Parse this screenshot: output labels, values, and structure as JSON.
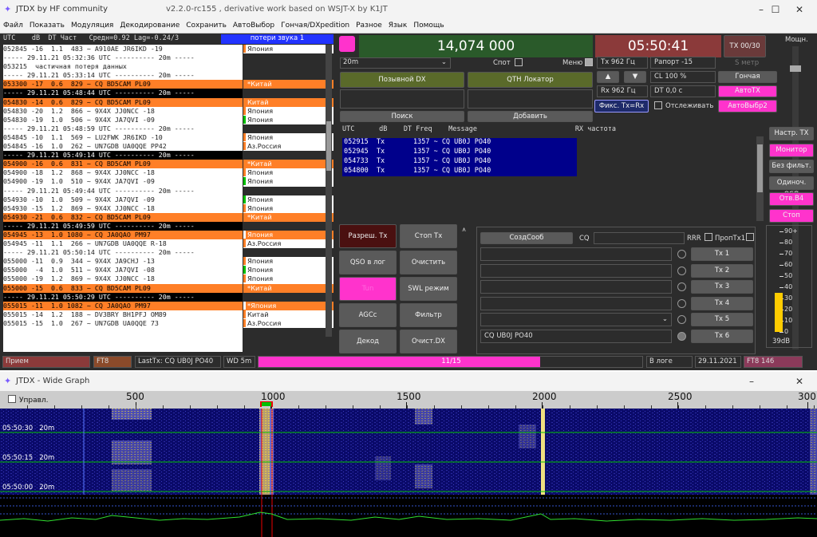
{
  "window": {
    "title": "JTDX  by HF community",
    "version": "v2.2.0-rc155 , derivative work based on WSJT-X by K1JT",
    "minimize": "–",
    "maximize": "☐",
    "close": "✕"
  },
  "menu": [
    "Файл",
    "Показать",
    "Модуляция",
    "Декодирование",
    "Сохранить",
    "АвтоВыбор",
    "Гончая/DXpedition",
    "Разное",
    "Язык",
    "Помощь"
  ],
  "header": {
    "utc": "UTC",
    "db": "dB",
    "dt": "DT",
    "freq": "Част",
    "avg": "Средн=0.92 Lag=-0.24/3",
    "loss": "потери звука 1"
  },
  "decodes": [
    {
      "t": "052845 -16  1.1  483 ~ A910AE JR6IKD -19",
      "k": "n",
      "c": "Япония",
      "cc": "#ff7f27"
    },
    {
      "t": "----- 29.11.21 05:32:36 UTC ---------- 20m -----",
      "k": "sep"
    },
    {
      "t": "053215  частичная потеря данных",
      "k": "n"
    },
    {
      "t": "----- 29.11.21 05:33:14 UTC ---------- 20m -----",
      "k": "sep"
    },
    {
      "t": "053300 -17  0.6  829 ~ CQ BD5CAM PL09",
      "k": "cq",
      "c": "*Китай",
      "cc": "#ff7f27"
    },
    {
      "t": "----- 29.11.21 05:48:44 UTC ---------- 20m -----",
      "k": "date"
    },
    {
      "t": "054830 -14  0.6  829 ~ CQ BD5CAM PL09",
      "k": "cq",
      "c": "Китай",
      "cc": "#ff7f27"
    },
    {
      "t": "054830 -20  1.2  866 ~ 9X4X JJ0NCC -18",
      "k": "n",
      "c": "Япония",
      "cc": "#ff7f27"
    },
    {
      "t": "054830 -19  1.0  506 ~ 9X4X JA7QVI -09",
      "k": "n",
      "c": "Япония",
      "cc": "#00c000"
    },
    {
      "t": "----- 29.11.21 05:48:59 UTC ---------- 20m -----",
      "k": "sep"
    },
    {
      "t": "054845 -10  1.1  569 ~ LU2FWK JR6IKD -10",
      "k": "n",
      "c": "Япония",
      "cc": "#ff7f27"
    },
    {
      "t": "054845 -16  1.0  262 ~ UN7GDB UA0QQE PP42",
      "k": "n",
      "c": "Аз.Россия",
      "cc": "#ff7f27"
    },
    {
      "t": "----- 29.11.21 05:49:14 UTC ---------- 20m -----",
      "k": "date"
    },
    {
      "t": "054900 -16  0.6  831 ~ CQ BD5CAM PL09",
      "k": "cq",
      "c": "*Китай",
      "cc": "#ff7f27"
    },
    {
      "t": "054900 -18  1.2  868 ~ 9X4X JJ0NCC -18",
      "k": "n",
      "c": "Япония",
      "cc": "#ff7f27"
    },
    {
      "t": "054900 -19  1.0  510 ~ 9X4X JA7QVI -09",
      "k": "n",
      "c": "Япония",
      "cc": "#00c000"
    },
    {
      "t": "----- 29.11.21 05:49:44 UTC ---------- 20m -----",
      "k": "sep"
    },
    {
      "t": "054930 -10  1.0  509 ~ 9X4X JA7QVI -09",
      "k": "n",
      "c": "Япония",
      "cc": "#00c000"
    },
    {
      "t": "054930 -15  1.2  869 ~ 9X4X JJ0NCC -18",
      "k": "n",
      "c": "Япония",
      "cc": "#ff7f27"
    },
    {
      "t": "054930 -21  0.6  832 ~ CQ BD5CAM PL09",
      "k": "cq",
      "c": "*Китай",
      "cc": "#ff7f27"
    },
    {
      "t": "----- 29.11.21 05:49:59 UTC ---------- 20m -----",
      "k": "date"
    },
    {
      "t": "054945 -13  1.0 1080 ~ CQ JA0QAO PM97",
      "k": "cq",
      "c": "Япония",
      "cc": "#fff"
    },
    {
      "t": "054945 -11  1.1  266 ~ UN7GDB UA0QQE R-18",
      "k": "n",
      "c": "Аз.Россия",
      "cc": "#ff7f27"
    },
    {
      "t": "----- 29.11.21 05:50:14 UTC ---------- 20m -----",
      "k": "sep"
    },
    {
      "t": "055000 -11  0.9  344 ~ 9X4X JA9CHJ -13",
      "k": "n",
      "c": "Япония",
      "cc": "#ff7f27"
    },
    {
      "t": "055000  -4  1.0  511 ~ 9X4X JA7QVI -08",
      "k": "n",
      "c": "Япония",
      "cc": "#00c000"
    },
    {
      "t": "055000 -19  1.2  869 ~ 9X4X JJ0NCC -18",
      "k": "n",
      "c": "Япония",
      "cc": "#ff7f27"
    },
    {
      "t": "055000 -15  0.6  833 ~ CQ BD5CAM PL09",
      "k": "cq",
      "c": "*Китай",
      "cc": "#ff7f27"
    },
    {
      "t": "----- 29.11.21 05:50:29 UTC ---------- 20m -----",
      "k": "date"
    },
    {
      "t": "055015 -11  1.0 1082 ~ CQ JA0QAO PM97",
      "k": "cq",
      "c": "*Япония",
      "cc": "#fff"
    },
    {
      "t": "055015 -14  1.2  188 ~ DV3BRY BH1PFJ OM89",
      "k": "n",
      "c": "Китай",
      "cc": "#ff7f27"
    },
    {
      "t": "055015 -15  1.0  267 ~ UN7GDB UA0QQE 73",
      "k": "n",
      "c": "Аз.Россия",
      "cc": "#ff7f27"
    }
  ],
  "top": {
    "freq": "14,074 000",
    "time": "05:50:41",
    "tx": "TX 00/30",
    "power": "Мощн.",
    "band": "20m",
    "spot": "Спот",
    "menu": "Меню",
    "tx_hz": "Tx  962  Гц",
    "rx_hz": "Rx  962  Гц",
    "report": "Рапорт  -15",
    "cl": "CL  100 %",
    "dt": "DT 0,0 с",
    "smeter": "S метр",
    "hound": "Гончая",
    "autotx": "АвтоTX",
    "autosel": "АвтоВыбр2",
    "fix": "Фикс. Tx=Rx",
    "track": "Отслеживать",
    "up": "▲",
    "down": "▼"
  },
  "dx": {
    "call_label": "Позывной DX",
    "qth_label": "QTH Локатор",
    "search": "Поиск",
    "add": "Добавить"
  },
  "rx_header": {
    "utc": "UTC",
    "db": "dB",
    "dt": "DT",
    "freq": "Freq",
    "msg": "Message",
    "title": "RX частота"
  },
  "rx_rows": [
    {
      "t": "052915  Tx       1357 ~ CQ UB0J PO40"
    },
    {
      "t": "052945  Tx       1357 ~ CQ UB0J PO40"
    },
    {
      "t": "054733  Tx       1357 ~ CQ UB0J PO40"
    },
    {
      "t": "054800  Tx       1357 ~ CQ UB0J PO40"
    }
  ],
  "right_buttons": [
    "Настр. TX",
    "Монитор",
    "Без фильт.",
    "Одиноч. QSO",
    "Отв.В4",
    "Стоп"
  ],
  "controls": {
    "enable_tx": "Разреш. Tx",
    "stop_tx": "Стоп Tx",
    "log_qso": "QSO в лог",
    "clear": "Очистить",
    "tune": "Tun",
    "swl": "SWL режим",
    "agc": "AGCc",
    "filter": "Фильтр",
    "decode": "Декод",
    "clear_dx": "Очист.DX"
  },
  "messages": {
    "create": "СоздСооб",
    "cq": "CQ",
    "rrr": "RRR",
    "skip": "ПропTx1",
    "tx6": "CQ UB0J PO40",
    "tx_btns": [
      "Tx 1",
      "Tx 2",
      "Tx 3",
      "Tx 4",
      "Tx 5",
      "Tx 6"
    ]
  },
  "meter": {
    "scale": [
      "90+",
      "80",
      "70",
      "60",
      "50",
      "40",
      "30",
      "20",
      "10",
      "0"
    ],
    "level": "39dB",
    "level_frac": 0.39
  },
  "status": {
    "mode": "Прием",
    "protocol": "FT8",
    "lasttx": "LastTx: CQ UB0J PO40",
    "wd": "WD 5m",
    "progress": "11/15",
    "progress_frac": 0.733,
    "log": "В логе",
    "date": "29.11.2021",
    "ft8": "FT8  146"
  },
  "wide": {
    "title": "JTDX - Wide Graph",
    "control": "Управл.",
    "ticks": [
      "500",
      "1000",
      "1500",
      "2000",
      "2500",
      "300"
    ],
    "times": [
      "05:50:30",
      "05:50:15",
      "05:50:00"
    ],
    "band": "20m"
  },
  "colors": {
    "orange": "#ff7f27",
    "magenta": "#ff33cc",
    "green": "#00c000",
    "navy": "#00008b"
  }
}
